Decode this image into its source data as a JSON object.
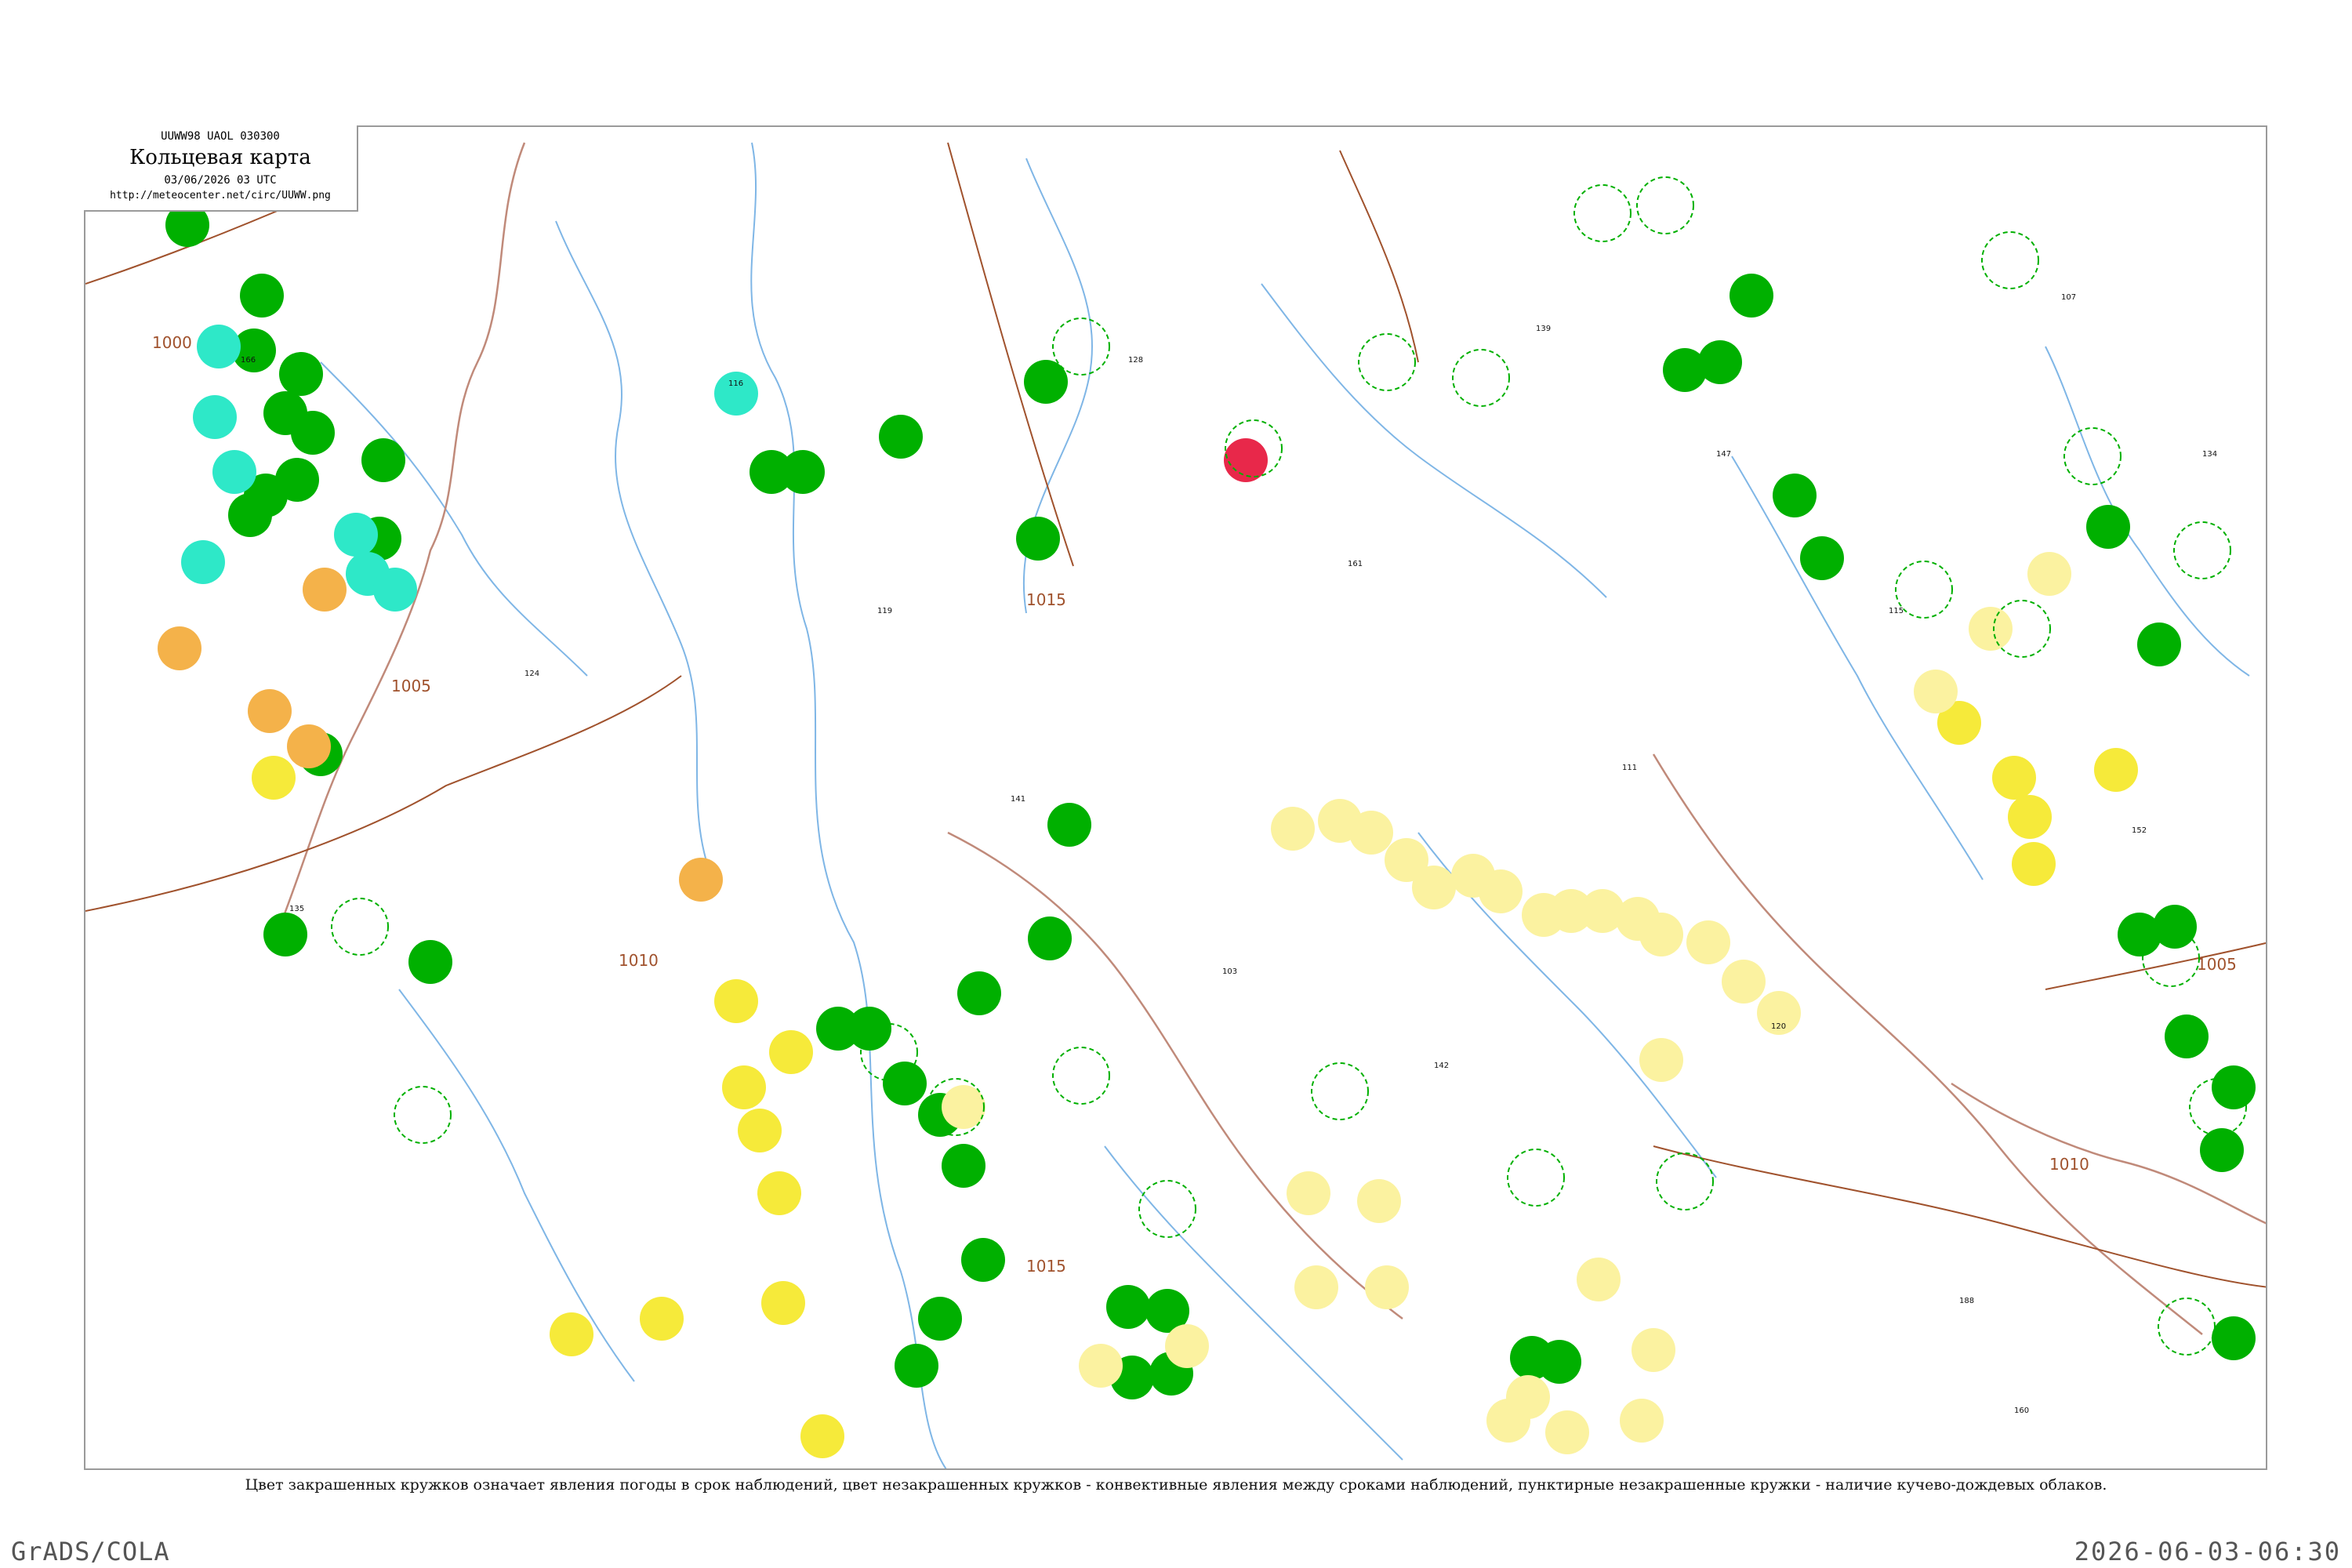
{
  "header": {
    "code": "UUWW98  UAOL  030300",
    "title": "Кольцевая карта",
    "date": "03/06/2026 03 UTC",
    "url": "http://meteocenter.net/circ/UUWW.png"
  },
  "isobars": [
    {
      "label": "1000"
    },
    {
      "label": "1005"
    },
    {
      "label": "1010"
    },
    {
      "label": "1015"
    },
    {
      "label": "1015"
    },
    {
      "label": "1010"
    },
    {
      "label": "1005"
    }
  ],
  "caption": "Цвет закрашенных кружков означает явления погоды в срок наблюдений, цвет незакрашенных кружков - конвективные явления между сроками наблюдений, пунктирные незакрашенные кружки - наличие кучево-дождевых облаков.",
  "footer": {
    "left": "GrADS/COLA",
    "right": "2026-06-03-06:30"
  },
  "colors": {
    "rain": "#00b000",
    "drizzle": "#2ee8c8",
    "haze": "#f4b24a",
    "smoke": "#f6ea3a",
    "light_yellow": "#fbf2a0",
    "thunder": "#e8284a",
    "isobar": "#a0522d",
    "river": "#7fb6e6",
    "border": "#c08a7a"
  },
  "stations": [
    {
      "value": "166"
    },
    {
      "value": "135"
    },
    {
      "value": "124"
    },
    {
      "value": "116"
    },
    {
      "value": "119"
    },
    {
      "value": "141"
    },
    {
      "value": "128"
    },
    {
      "value": "103"
    },
    {
      "value": "161"
    },
    {
      "value": "142"
    },
    {
      "value": "139"
    },
    {
      "value": "111"
    },
    {
      "value": "147"
    },
    {
      "value": "120"
    },
    {
      "value": "115"
    },
    {
      "value": "188"
    },
    {
      "value": "107"
    },
    {
      "value": "152"
    },
    {
      "value": "134"
    },
    {
      "value": "160"
    }
  ]
}
